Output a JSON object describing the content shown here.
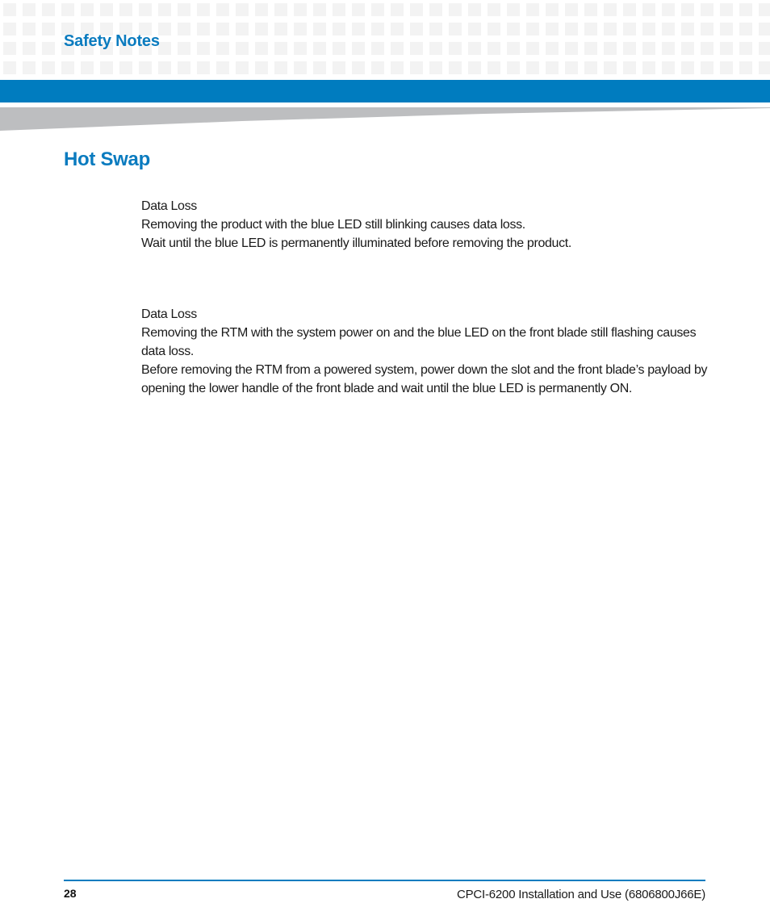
{
  "header": {
    "section_title": "Safety Notes",
    "accent_color": "#007cbf"
  },
  "page": {
    "heading": "Hot Swap"
  },
  "notes": [
    {
      "title": "Data Loss",
      "paragraphs": [
        "Removing the product with the blue LED still blinking causes data loss.",
        "Wait until the blue LED is permanently illuminated before removing the product."
      ]
    },
    {
      "title": "Data Loss",
      "paragraphs": [
        "Removing the RTM with the system power on and the blue LED on the front blade still flashing causes data loss.",
        "Before removing the RTM from a powered system, power down the slot and the front blade’s payload by opening the lower handle of the front blade and wait until the blue LED is permanently ON."
      ]
    }
  ],
  "footer": {
    "page_number": "28",
    "document_title": "CPCI-6200 Installation and Use (6806800J66E)"
  }
}
